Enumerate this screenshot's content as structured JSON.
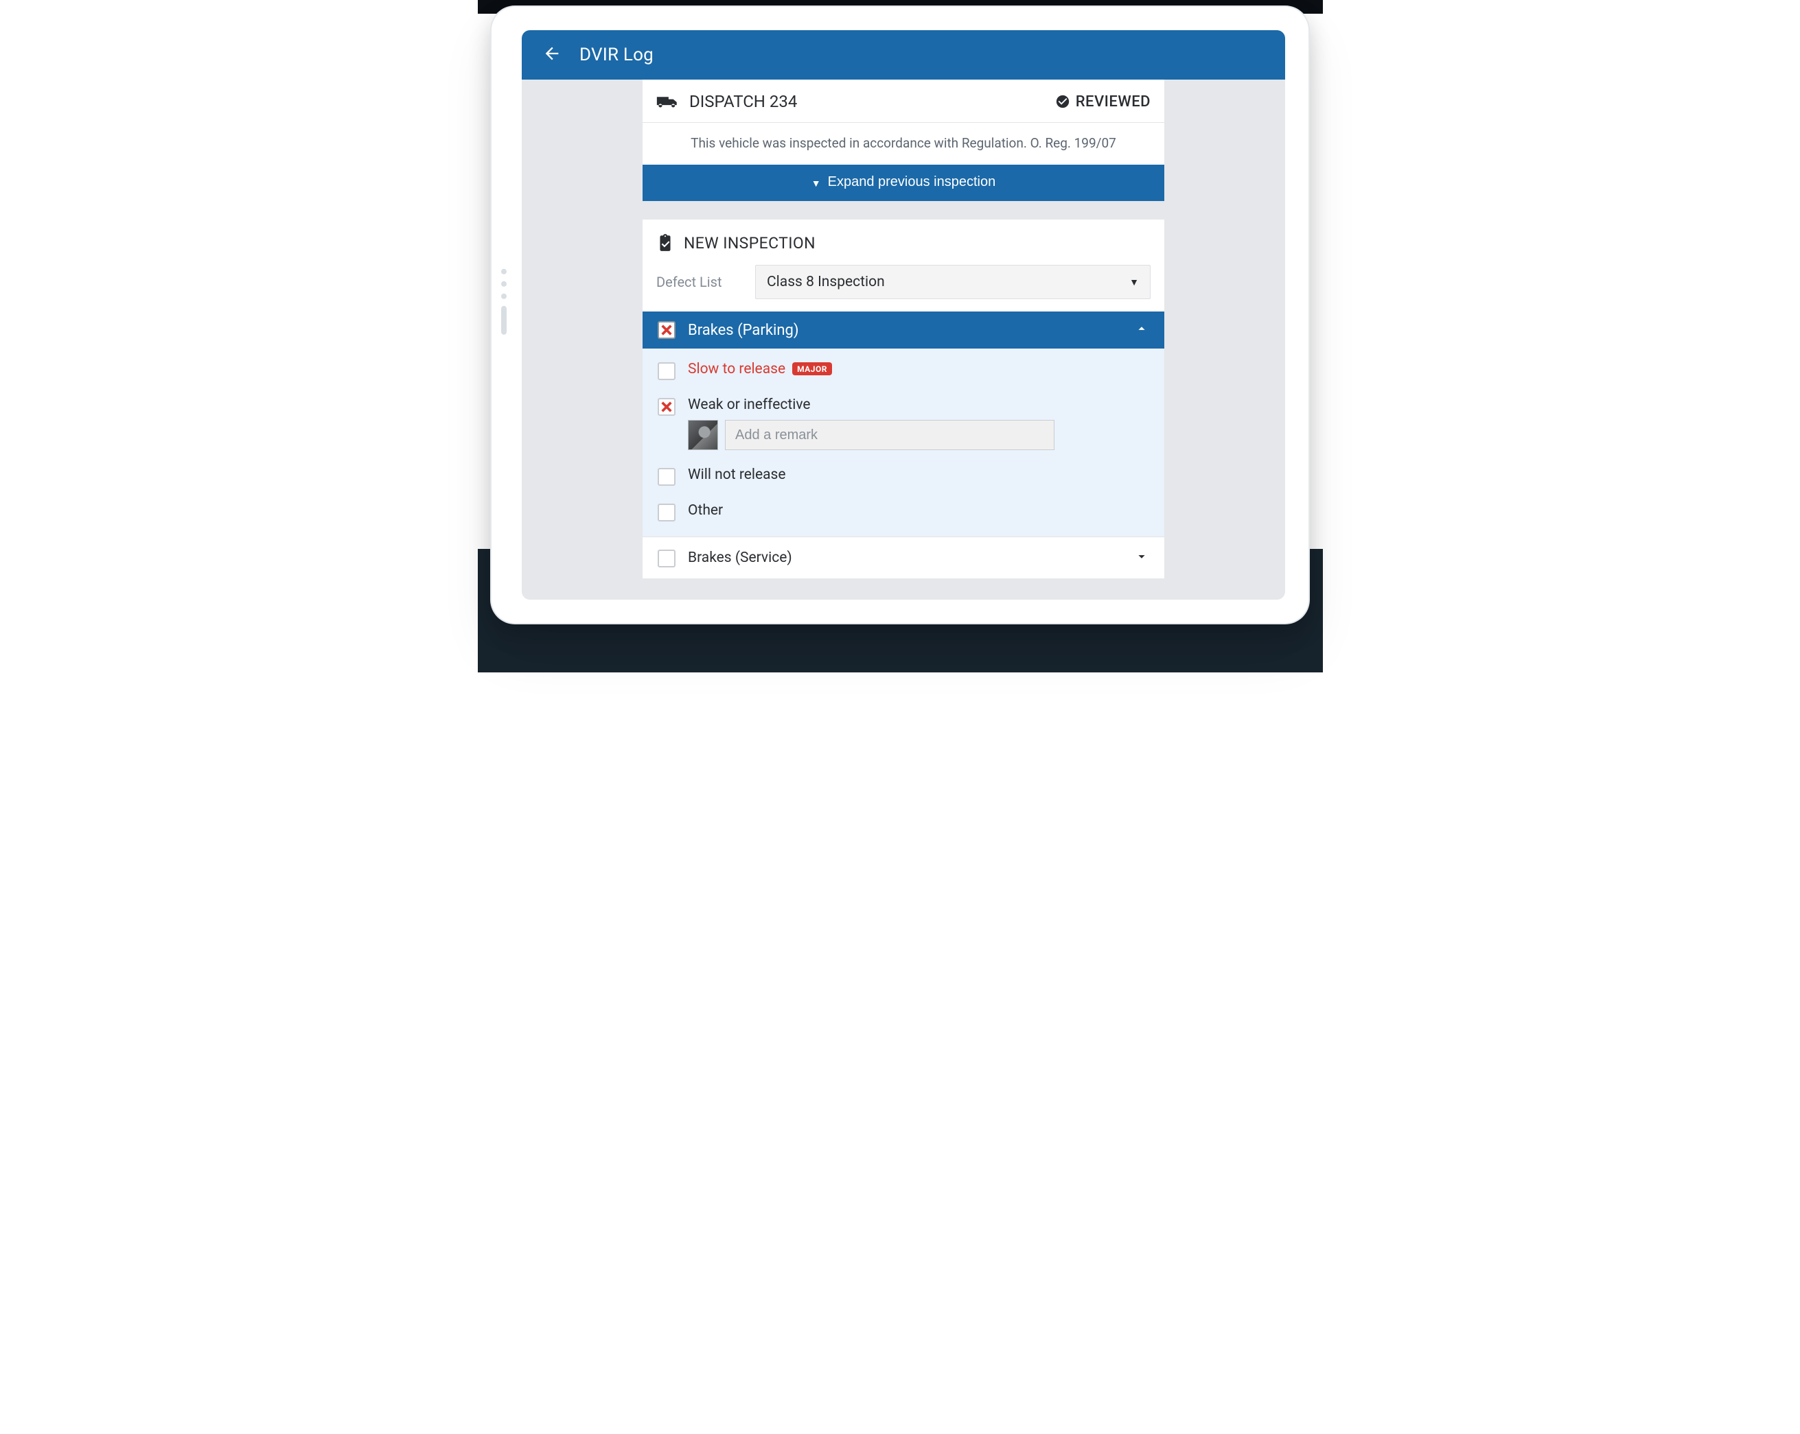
{
  "appbar": {
    "title": "DVIR Log"
  },
  "vehicle": {
    "name": "DISPATCH 234",
    "status": "REVIEWED",
    "note": "This vehicle was inspected in accordance with Regulation. O. Reg. 199/07",
    "expand_label": "Expand previous inspection"
  },
  "inspection": {
    "title": "NEW INSPECTION",
    "defect_list_label": "Defect List",
    "defect_list_value": "Class 8 Inspection"
  },
  "group": {
    "title": "Brakes (Parking)",
    "items": {
      "slow": {
        "label": "Slow to release",
        "badge": "MAJOR"
      },
      "weak": {
        "label": "Weak or ineffective",
        "remark_placeholder": "Add a remark"
      },
      "wont": {
        "label": "Will not release"
      },
      "other": {
        "label": "Other"
      }
    }
  },
  "next_section": {
    "title": "Brakes (Service)"
  }
}
